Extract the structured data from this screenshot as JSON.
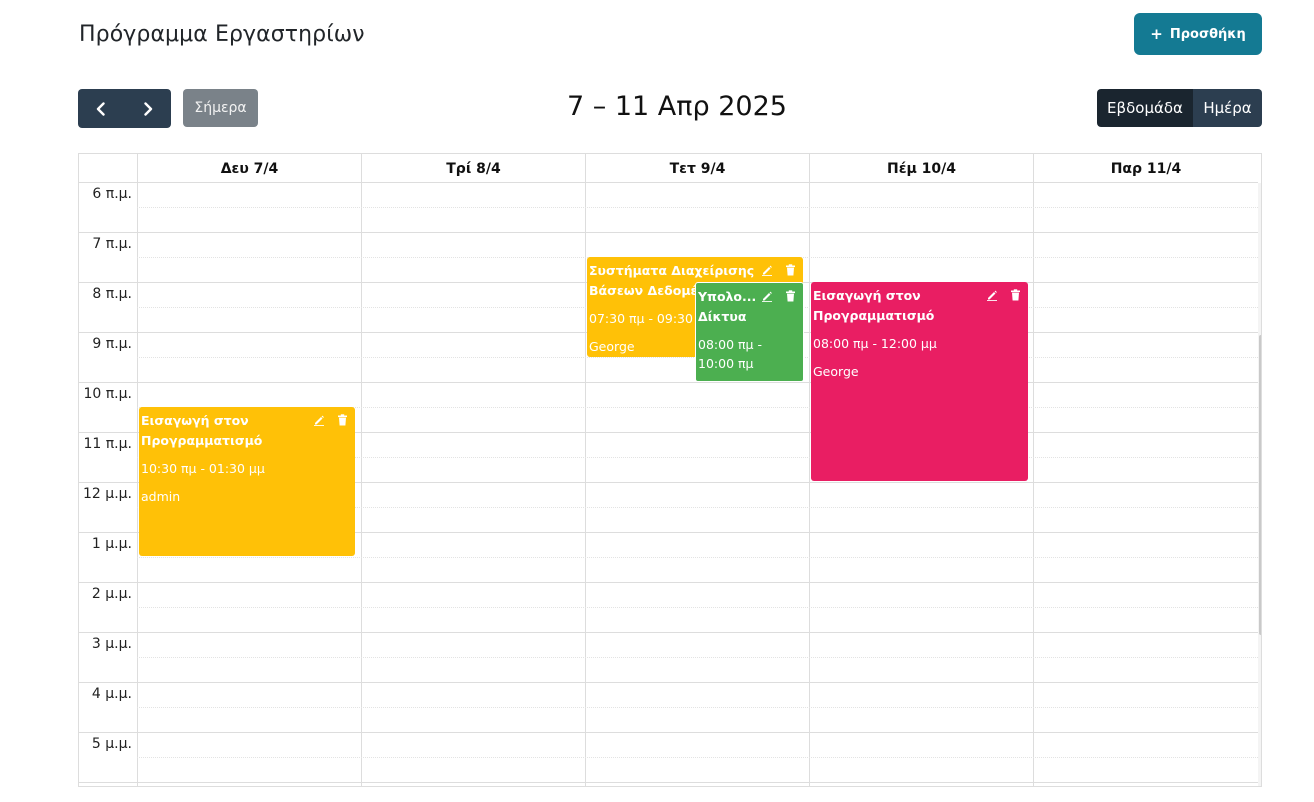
{
  "header": {
    "title": "Πρόγραμμα Εργαστηρίων",
    "add_label": "Προσθήκη"
  },
  "toolbar": {
    "today_label": "Σήμερα",
    "range_title": "7 – 11 Απρ 2025",
    "views": [
      "Εβδομάδα",
      "Ημέρα"
    ],
    "active_view": "Εβδομάδα"
  },
  "calendar": {
    "days": [
      "Δευ 7/4",
      "Τρί 8/4",
      "Τετ 9/4",
      "Πέμ 10/4",
      "Παρ 11/4"
    ],
    "hours": [
      "6 π.μ.",
      "7 π.μ.",
      "8 π.μ.",
      "9 π.μ.",
      "10 π.μ.",
      "11 π.μ.",
      "12 μ.μ.",
      "1 μ.μ.",
      "2 μ.μ.",
      "3 μ.μ.",
      "4 μ.μ.",
      "5 μ.μ."
    ],
    "events": [
      {
        "title": "Εισαγωγή στον Προγραμματισμό",
        "time": "10:30 πμ - 01:30 μμ",
        "user": "admin",
        "color": "#ffc107"
      },
      {
        "title": "Συστήματα Διαχείρισης Βάσεων Δεδομένων",
        "time": "07:30 πμ - 09:30 πμ",
        "user": "George",
        "color": "#ffc107"
      },
      {
        "title": "Υπολο... Δίκτυα",
        "time": "08:00 πμ - 10:00 πμ",
        "user": "",
        "color": "#4caf50"
      },
      {
        "title": "Εισαγωγή στον Προγραμματισμό",
        "time": "08:00 πμ - 12:00 μμ",
        "user": "George",
        "color": "#e91e63"
      }
    ]
  },
  "icons": {
    "nav_prev": "chevron-left-icon",
    "nav_next": "chevron-right-icon",
    "edit": "pencil-icon",
    "delete": "trash-icon",
    "add": "plus-icon"
  }
}
